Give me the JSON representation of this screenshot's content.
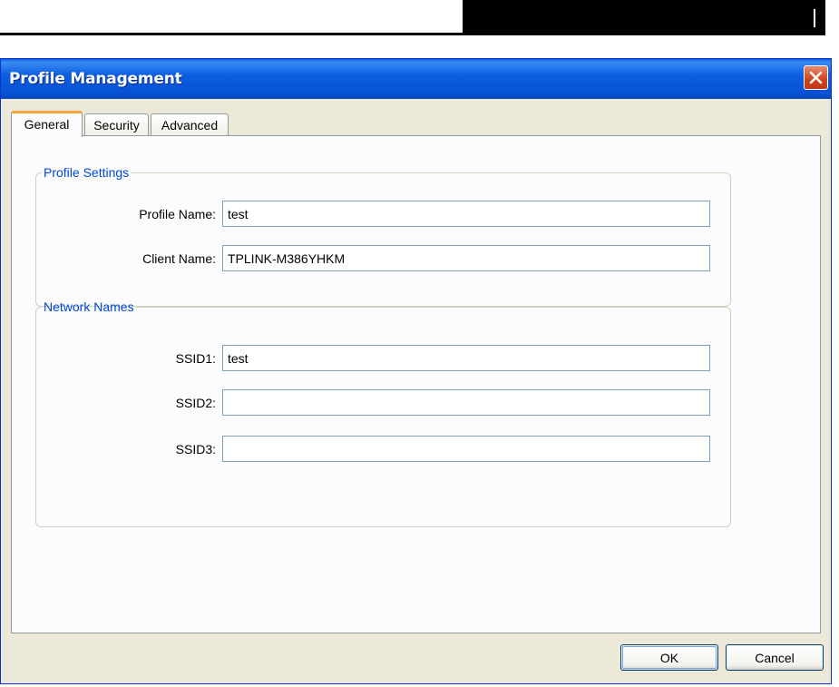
{
  "window": {
    "title": "Profile Management",
    "close_icon": "close-x-icon"
  },
  "tabs": [
    {
      "label": "General",
      "active": true
    },
    {
      "label": "Security",
      "active": false
    },
    {
      "label": "Advanced",
      "active": false
    }
  ],
  "profile_settings": {
    "legend": "Profile Settings",
    "profile_name_label": "Profile Name:",
    "profile_name_value": "test",
    "client_name_label": "Client Name:",
    "client_name_value": "TPLINK-M386YHKM"
  },
  "network_names": {
    "legend": "Network Names",
    "ssid1_label": "SSID1:",
    "ssid1_value": "test",
    "ssid2_label": "SSID2:",
    "ssid2_value": "",
    "ssid3_label": "SSID3:",
    "ssid3_value": ""
  },
  "buttons": {
    "ok": "OK",
    "cancel": "Cancel"
  },
  "colors": {
    "titlebar": "#0652d6",
    "group_legend": "#0046d5",
    "active_tab_accent": "#f7a43a",
    "close_button": "#d0401f"
  }
}
